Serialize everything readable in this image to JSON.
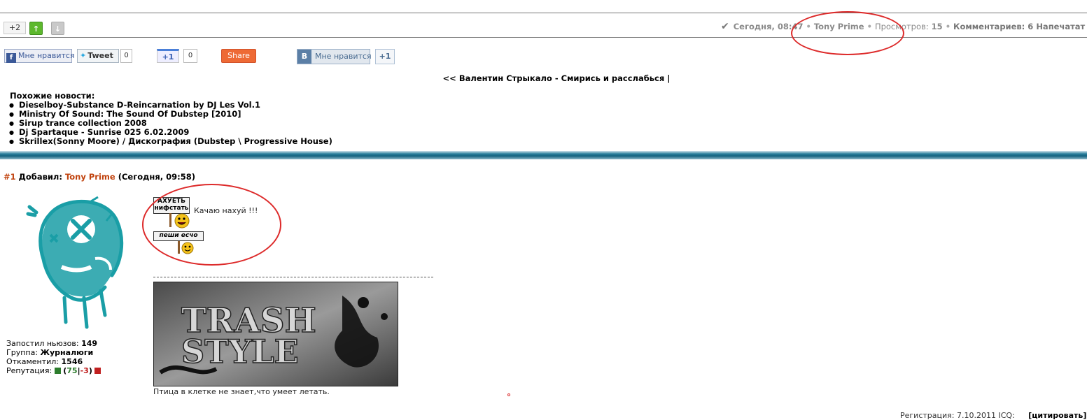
{
  "rating": {
    "count": "+2",
    "up_icon": "arrow-up-icon",
    "down_icon": "arrow-down-icon"
  },
  "meta": {
    "date": "Сегодня, 08:47",
    "author": "Tony Prime",
    "views_label": "Просмотров:",
    "views": "15",
    "comments_label": "Комментариев: 6",
    "print_label": "Напечатат"
  },
  "social": {
    "fb_like": "Мне нравится",
    "tweet": "Tweet",
    "tweet_count": "0",
    "gplus": "+1",
    "gplus_count": "0",
    "share": "Share",
    "vk_letter": "В",
    "vk_like": "Мне нравится",
    "vk_count": "+1"
  },
  "nav": {
    "prev": "<< Валентин Стрыкало - Смирись и расслабься |"
  },
  "related": {
    "title": "Похожие новости:",
    "items": [
      "Dieselboy-Substance D-Reincarnation by DJ Les Vol.1",
      "Ministry Of Sound: The Sound Of Dubstep [2010]",
      "Sirup trance collection 2008",
      "Dj Spartaque - Sunrise 025 6.02.2009",
      "Skrillex(Sonny Moore) / Дискография (Dubstep \\ Progressive House)"
    ]
  },
  "comment": {
    "number": "#1",
    "added_label": "Добавил:",
    "author": "Tony Prime",
    "time": "(Сегодня, 09:58)",
    "sign1_line1": "АХУЕТЬ",
    "sign1_line2": "нифстать",
    "text": "Качаю нахуй !!!",
    "sign2": "пеши есчо",
    "banner_line1": "TRASH",
    "banner_line2": "STYLE",
    "signature": "Птица в клетке не знает,что умеет летать."
  },
  "user_info": {
    "posts_label": "Запостил ньюзов:",
    "posts": "149",
    "group_label": "Группа:",
    "group": "Журналюги",
    "comments_label": "Откаментил:",
    "comments": "1546",
    "rep_label": "Репутация:",
    "rep_plus": "75",
    "rep_minus": "-3"
  },
  "footer": {
    "reg": "Регистрация: 7.10.2011 ICQ:",
    "quote": "[цитировать]"
  },
  "colors": {
    "accent": "#c0410c",
    "annotation": "#dd2a2a",
    "stripe": "#14627f",
    "avatar": "#1a9ea6"
  }
}
